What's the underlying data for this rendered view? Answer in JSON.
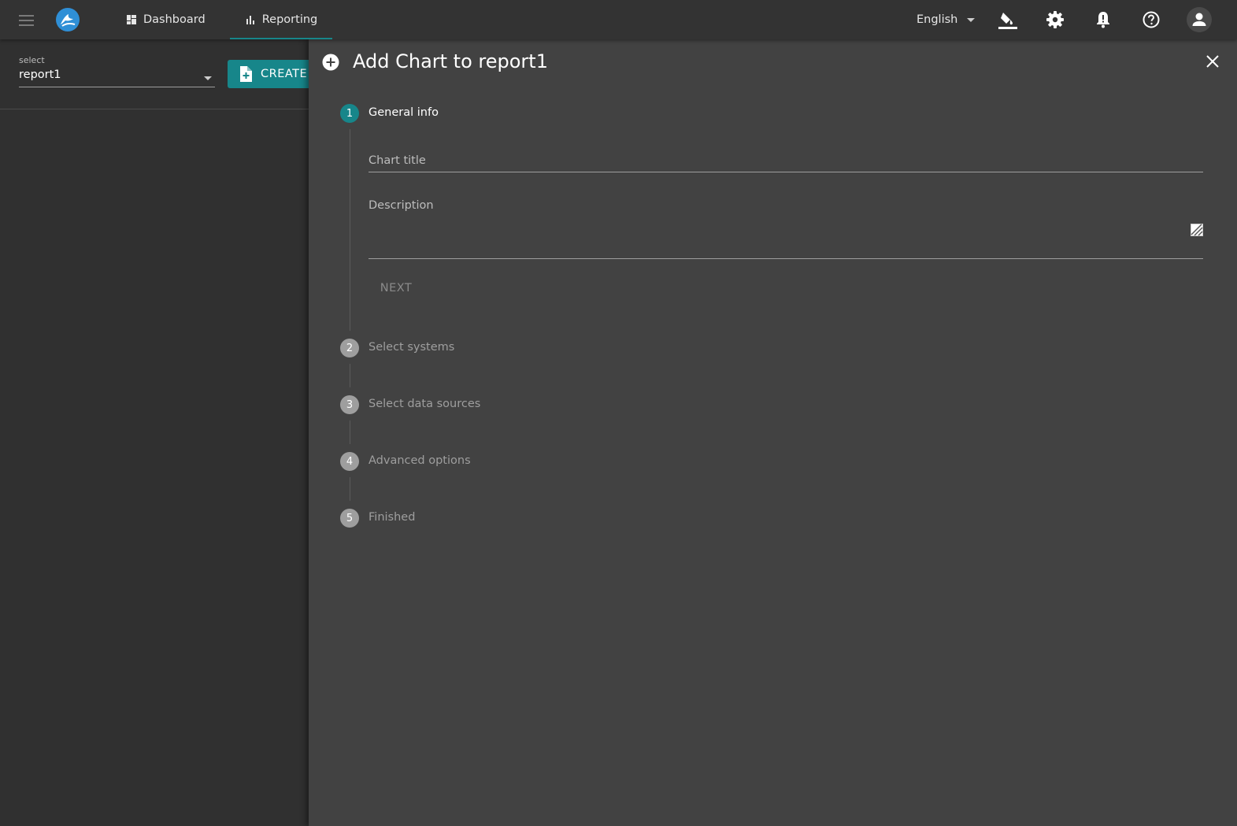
{
  "topbar": {
    "nav": [
      {
        "label": "Dashboard",
        "icon": "dashboard-icon"
      },
      {
        "label": "Reporting",
        "icon": "bar-chart-icon",
        "active": true
      }
    ],
    "language": "English",
    "icons": [
      "paint-bucket-icon",
      "gear-icon",
      "bell-alert-icon",
      "help-circle-icon",
      "account-icon"
    ]
  },
  "left": {
    "select_label": "select",
    "select_value": "report1",
    "create_label": "CREATE"
  },
  "dialog": {
    "title": "Add Chart to report1",
    "chart_title_placeholder": "Chart title",
    "description_placeholder": "Description",
    "next_label": "NEXT",
    "steps": [
      {
        "number": "1",
        "label": "General info",
        "active": true
      },
      {
        "number": "2",
        "label": "Select systems"
      },
      {
        "number": "3",
        "label": "Select data sources"
      },
      {
        "number": "4",
        "label": "Advanced options"
      },
      {
        "number": "5",
        "label": "Finished"
      }
    ]
  },
  "colors": {
    "accent": "#17868a",
    "topbar": "#333333",
    "background": "#303030",
    "dialog": "#424242"
  }
}
